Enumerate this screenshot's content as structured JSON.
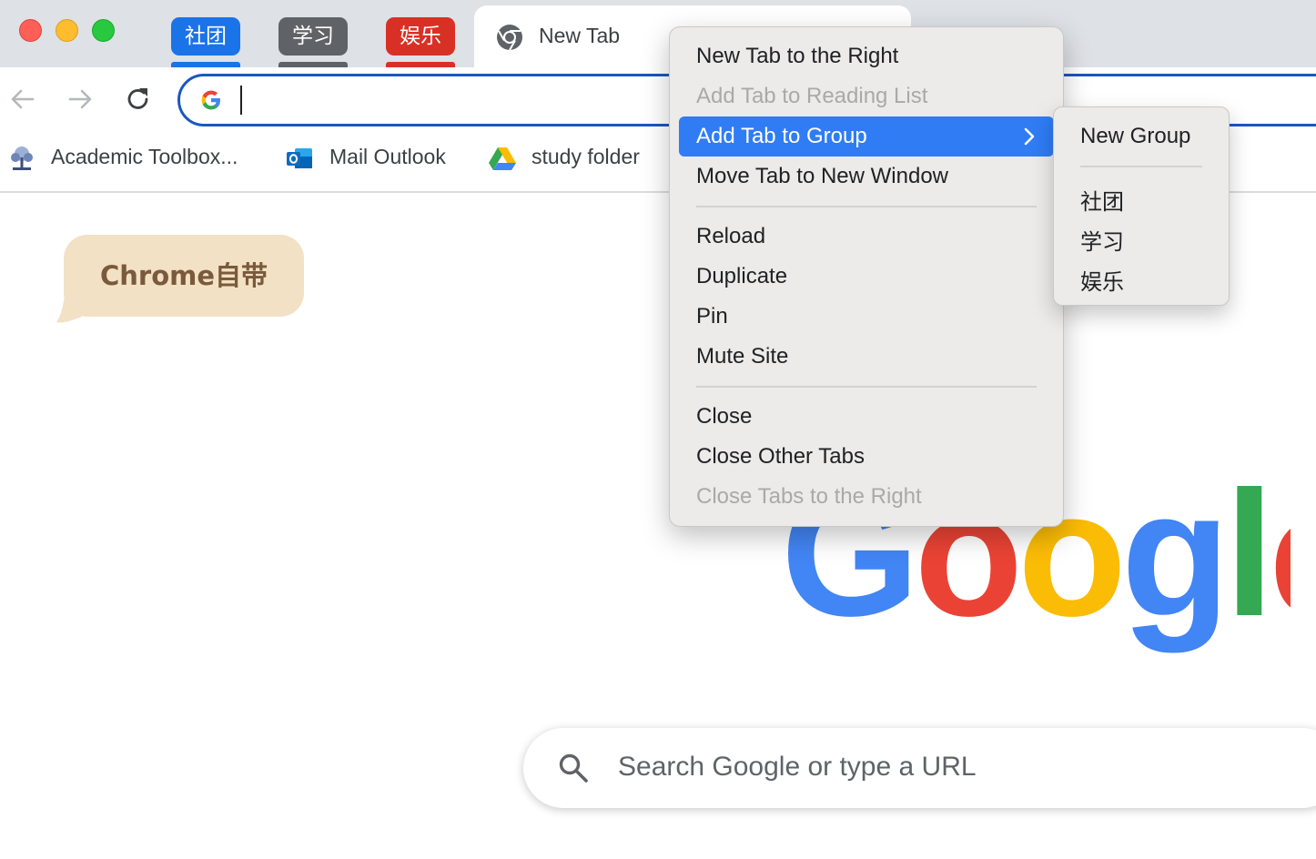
{
  "window": {
    "traffic_lights": [
      "close",
      "minimize",
      "zoom"
    ]
  },
  "tab_groups": [
    {
      "label": "社团",
      "color": "#1a73e8"
    },
    {
      "label": "学习",
      "color": "#5f6368"
    },
    {
      "label": "娱乐",
      "color": "#d93025"
    }
  ],
  "active_tab": {
    "title": "New Tab",
    "icon": "chrome-icon"
  },
  "toolbar": {
    "back": "back-arrow-icon",
    "forward": "forward-arrow-icon",
    "reload": "reload-icon",
    "omnibox_value": ""
  },
  "bookmarks": [
    {
      "label": "Academic Toolbox...",
      "icon": "tree-icon"
    },
    {
      "label": "Mail Outlook",
      "icon": "outlook-icon"
    },
    {
      "label": "study folder",
      "icon": "drive-icon"
    }
  ],
  "annotation": {
    "text": "Chrome自带"
  },
  "new_tab_page": {
    "logo": "Google",
    "search_placeholder": "Search Google or type a URL"
  },
  "context_menu": {
    "items": [
      {
        "label": "New Tab to the Right",
        "enabled": true
      },
      {
        "label": "Add Tab to Reading List",
        "enabled": false
      },
      {
        "label": "Add Tab to Group",
        "enabled": true,
        "highlighted": true,
        "submenu": true
      },
      {
        "label": "Move Tab to New Window",
        "enabled": true
      },
      {
        "label": "Reload",
        "enabled": true
      },
      {
        "label": "Duplicate",
        "enabled": true
      },
      {
        "label": "Pin",
        "enabled": true
      },
      {
        "label": "Mute Site",
        "enabled": true
      },
      {
        "label": "Close",
        "enabled": true
      },
      {
        "label": "Close Other Tabs",
        "enabled": true
      },
      {
        "label": "Close Tabs to the Right",
        "enabled": false
      }
    ],
    "highlight_color": "#2f7cf5"
  },
  "group_submenu": {
    "items": [
      {
        "label": "New Group"
      },
      {
        "label": "社团"
      },
      {
        "label": "学习"
      },
      {
        "label": "娱乐"
      }
    ]
  }
}
